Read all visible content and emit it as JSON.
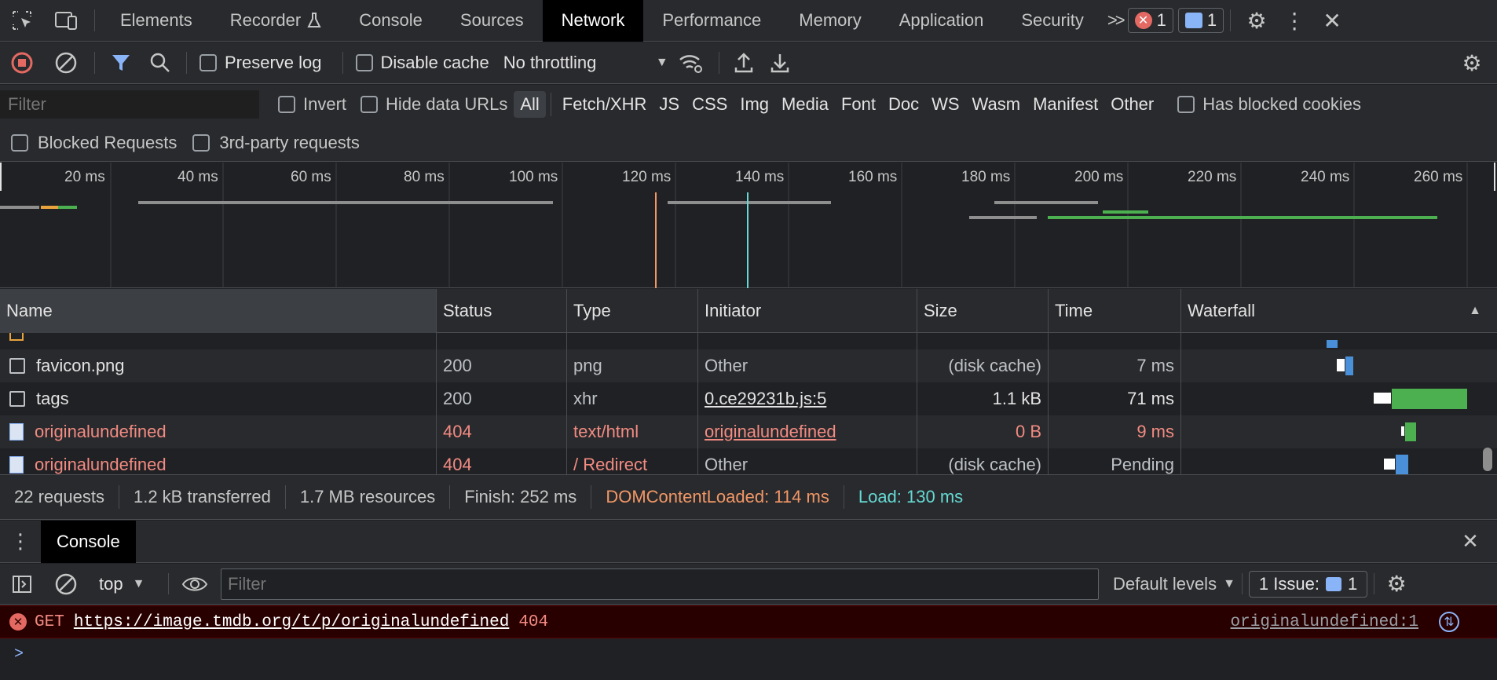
{
  "topbar": {
    "tabs": [
      "Elements",
      "Recorder",
      "Console",
      "Sources",
      "Network",
      "Performance",
      "Memory",
      "Application",
      "Security"
    ],
    "active_tab": "Network",
    "more": ">>",
    "error_count": "1",
    "message_count": "1"
  },
  "network_toolbar": {
    "preserve_log": "Preserve log",
    "disable_cache": "Disable cache",
    "throttling": "No throttling"
  },
  "filter_bar": {
    "placeholder": "Filter",
    "invert": "Invert",
    "hide_data_urls": "Hide data URLs",
    "types": [
      "All",
      "Fetch/XHR",
      "JS",
      "CSS",
      "Img",
      "Media",
      "Font",
      "Doc",
      "WS",
      "Wasm",
      "Manifest",
      "Other"
    ],
    "has_blocked_cookies": "Has blocked cookies",
    "blocked_requests": "Blocked Requests",
    "third_party": "3rd-party requests"
  },
  "overview": {
    "ticks": [
      "20 ms",
      "40 ms",
      "60 ms",
      "80 ms",
      "100 ms",
      "120 ms",
      "140 ms",
      "160 ms",
      "180 ms",
      "200 ms",
      "220 ms",
      "240 ms",
      "260 ms"
    ]
  },
  "table": {
    "headers": [
      "Name",
      "Status",
      "Type",
      "Initiator",
      "Size",
      "Time",
      "Waterfall"
    ],
    "rows": [
      {
        "name": "favicon.png",
        "status": "200",
        "type": "png",
        "initiator": "Other",
        "size": "(disk cache)",
        "time": "7 ms",
        "error": false,
        "initiator_link": false
      },
      {
        "name": "tags",
        "status": "200",
        "type": "xhr",
        "initiator": "0.ce29231b.js:5",
        "size": "1.1 kB",
        "time": "71 ms",
        "error": false,
        "initiator_link": true
      },
      {
        "name": "originalundefined",
        "status": "404",
        "type": "text/html",
        "initiator": "originalundefined",
        "size": "0 B",
        "time": "9 ms",
        "error": true,
        "initiator_link": true
      },
      {
        "name": "originalundefined",
        "status": "404",
        "type": "/ Redirect",
        "initiator": "Other",
        "size": "(disk cache)",
        "time": "Pending",
        "error": true,
        "initiator_link": false
      }
    ]
  },
  "summary": {
    "requests": "22 requests",
    "transferred": "1.2 kB transferred",
    "resources": "1.7 MB resources",
    "finish": "Finish: 252 ms",
    "dom_content_loaded": "DOMContentLoaded: 114 ms",
    "load": "Load: 130 ms"
  },
  "console": {
    "tab": "Console",
    "context": "top",
    "filter_placeholder": "Filter",
    "levels": "Default levels",
    "issues_label": "1 Issue:",
    "issues_count": "1",
    "error_method": "GET",
    "error_url": "https://image.tmdb.org/t/p/originalundefined",
    "error_status": "404",
    "error_source": "originalundefined:1",
    "prompt": ">"
  },
  "colors": {
    "dcl": "#f29766",
    "load": "#65d9d3",
    "error": "#f28b82",
    "active_filter": "#8ab4f8"
  }
}
